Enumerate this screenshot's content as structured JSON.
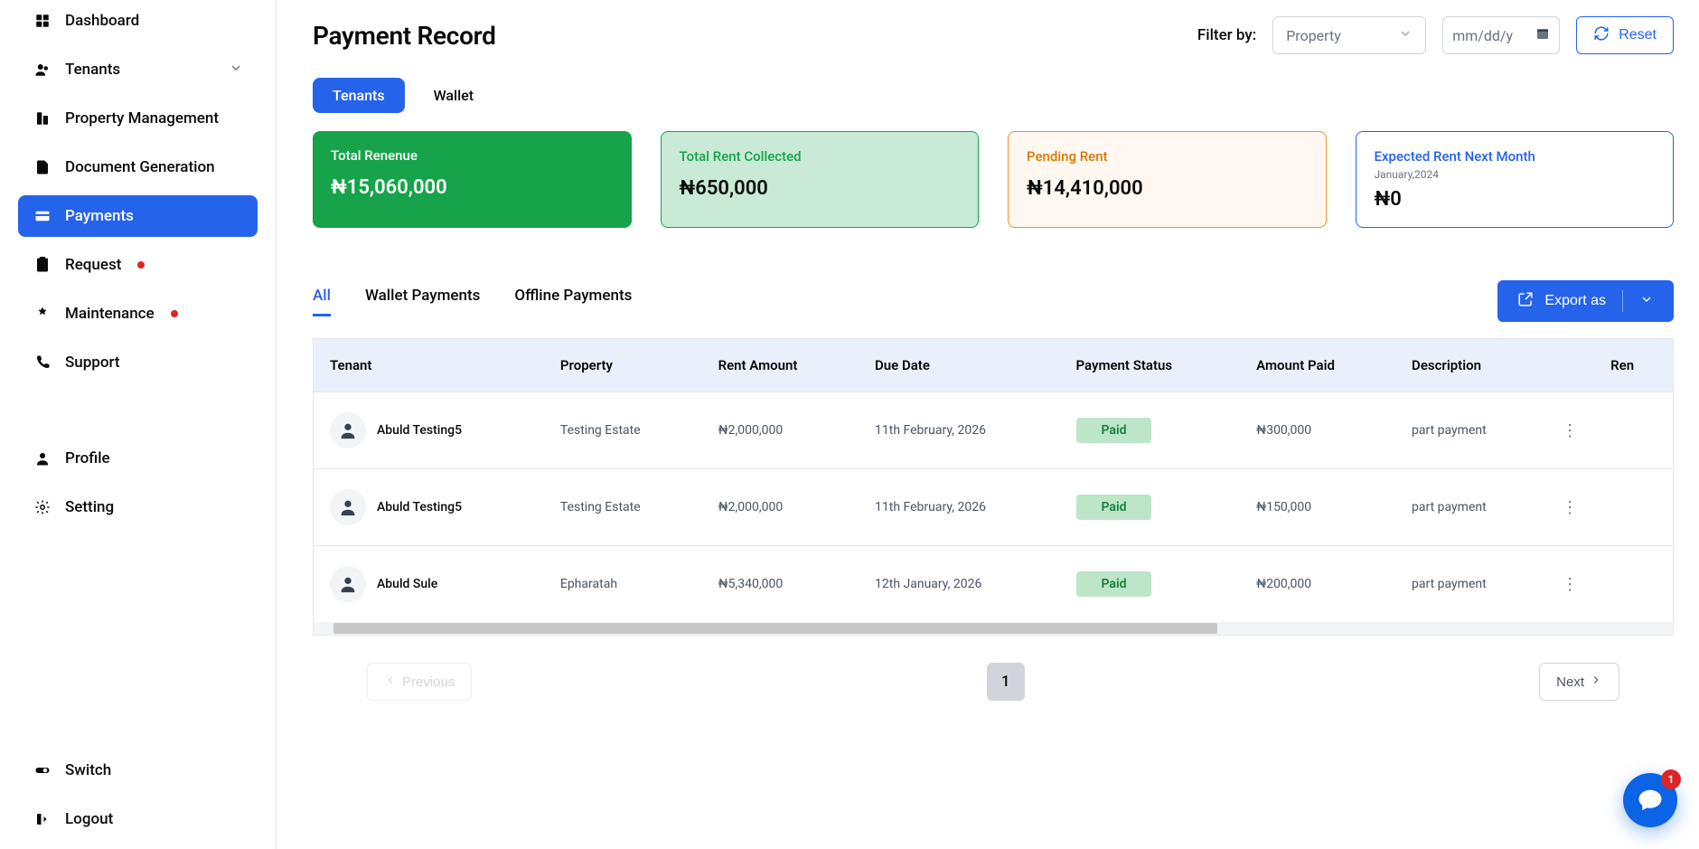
{
  "sidebar": {
    "items": [
      {
        "id": "dashboard",
        "label": "Dashboard",
        "has_chevron": false,
        "has_dot": false
      },
      {
        "id": "tenants",
        "label": "Tenants",
        "has_chevron": true,
        "has_dot": false
      },
      {
        "id": "property-management",
        "label": "Property Management",
        "has_chevron": false,
        "has_dot": false
      },
      {
        "id": "document-generation",
        "label": "Document Generation",
        "has_chevron": false,
        "has_dot": false
      },
      {
        "id": "payments",
        "label": "Payments",
        "has_chevron": false,
        "has_dot": false
      },
      {
        "id": "request",
        "label": "Request",
        "has_chevron": false,
        "has_dot": true
      },
      {
        "id": "maintenance",
        "label": "Maintenance",
        "has_chevron": false,
        "has_dot": true
      },
      {
        "id": "support",
        "label": "Support",
        "has_chevron": false,
        "has_dot": false
      }
    ],
    "active_id": "payments",
    "profile_label": "Profile",
    "setting_label": "Setting",
    "switch_label": "Switch",
    "logout_label": "Logout"
  },
  "header": {
    "title": "Payment Record",
    "filter_label": "Filter by:",
    "property_select_placeholder": "Property",
    "date_placeholder": "mm/dd/y",
    "reset_label": "Reset"
  },
  "main_tabs": {
    "active": "tenants",
    "tenants_label": "Tenants",
    "wallet_label": "Wallet"
  },
  "cards": {
    "revenue": {
      "title": "Total Renenue",
      "value": "₦15,060,000"
    },
    "collected": {
      "title": "Total Rent Collected",
      "value": "₦650,000"
    },
    "pending": {
      "title": "Pending Rent",
      "value": "₦14,410,000"
    },
    "expected": {
      "title": "Expected Rent Next Month",
      "sub": "January,2024",
      "value": "₦0"
    }
  },
  "table_tabs": {
    "active": "all",
    "all_label": "All",
    "wallet_label": "Wallet Payments",
    "offline_label": "Offline Payments"
  },
  "export_label": "Export as",
  "table": {
    "columns": [
      "Tenant",
      "Property",
      "Rent Amount",
      "Due Date",
      "Payment Status",
      "Amount Paid",
      "Description",
      "Ren"
    ],
    "rows": [
      {
        "tenant": "Abuld Testing5",
        "property": "Testing Estate",
        "rent": "₦2,000,000",
        "due": "11th February, 2026",
        "status": "Paid",
        "paid": "₦300,000",
        "desc": "part payment"
      },
      {
        "tenant": "Abuld Testing5",
        "property": "Testing Estate",
        "rent": "₦2,000,000",
        "due": "11th February, 2026",
        "status": "Paid",
        "paid": "₦150,000",
        "desc": "part payment"
      },
      {
        "tenant": "Abuld Sule",
        "property": "Epharatah",
        "rent": "₦5,340,000",
        "due": "12th January, 2026",
        "status": "Paid",
        "paid": "₦200,000",
        "desc": "part payment"
      }
    ]
  },
  "pagination": {
    "prev_label": "Previous",
    "next_label": "Next",
    "current_page": "1"
  },
  "chat_badge": "1"
}
